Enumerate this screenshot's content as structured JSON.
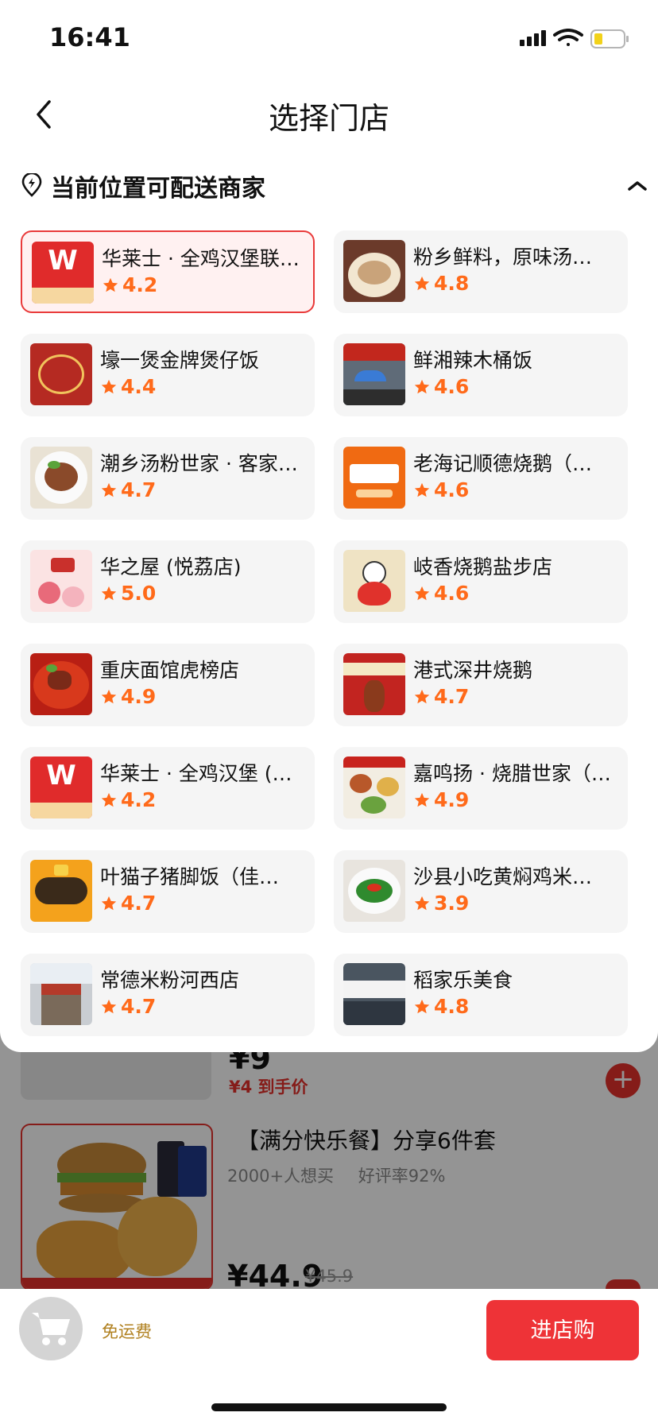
{
  "status_bar": {
    "time": "16:41"
  },
  "header": {
    "title": "选择门店"
  },
  "section": {
    "title": "当前位置可配送商家"
  },
  "stores": [
    {
      "name": "华莱士 · 全鸡汉堡联…",
      "rating": "4.2",
      "thumb": "wallace-logo",
      "selected": true
    },
    {
      "name": "粉乡鲜料，原味汤…",
      "rating": "4.8",
      "thumb": "noodle-bowl"
    },
    {
      "name": "壕一煲金牌煲仔饭",
      "rating": "4.4",
      "thumb": "claypot-logo"
    },
    {
      "name": "鲜湘辣木桶饭",
      "rating": "4.6",
      "thumb": "storefront"
    },
    {
      "name": "潮乡汤粉世家 · 客家…",
      "rating": "4.7",
      "thumb": "rice-bowl"
    },
    {
      "name": "老海记顺德烧鹅（…",
      "rating": "4.6",
      "thumb": "laohaiji-logo"
    },
    {
      "name": "华之屋 (悦荔店)",
      "rating": "5.0",
      "thumb": "lychee-cake"
    },
    {
      "name": "岐香烧鹅盐步店",
      "rating": "4.6",
      "thumb": "goose-cartoon"
    },
    {
      "name": "重庆面馆虎榜店",
      "rating": "4.9",
      "thumb": "spicy-noodle"
    },
    {
      "name": "港式深井烧鹅",
      "rating": "4.7",
      "thumb": "roast-goose-sign"
    },
    {
      "name": "华莱士 · 全鸡汉堡 (…",
      "rating": "4.2",
      "thumb": "wallace-logo"
    },
    {
      "name": "嘉鸣扬 · 烧腊世家（…",
      "rating": "4.9",
      "thumb": "bbq-menu"
    },
    {
      "name": "叶猫子猪脚饭（佳…",
      "rating": "4.7",
      "thumb": "yemaozi-logo"
    },
    {
      "name": "沙县小吃黄焖鸡米…",
      "rating": "3.9",
      "thumb": "pepper-dish"
    },
    {
      "name": "常德米粉河西店",
      "rating": "4.7",
      "thumb": "shop-front"
    },
    {
      "name": "稻家乐美食",
      "rating": "4.8",
      "thumb": "daojiale-sign"
    }
  ],
  "background_products": [
    {
      "price": "¥9",
      "real_price": "¥4 到手价"
    },
    {
      "title": "【满分快乐餐】分享6件套",
      "sales": "2000+人想买",
      "good_rate": "好评率92%",
      "price": "¥44.9",
      "orig_price": "¥45.9"
    }
  ],
  "bottom_bar": {
    "free_delivery": "免运费",
    "enter_store": "进店购"
  },
  "colors": {
    "accent_red": "#ee3337",
    "rating_orange": "#ff6a1a",
    "card_bg": "#f5f5f5"
  }
}
